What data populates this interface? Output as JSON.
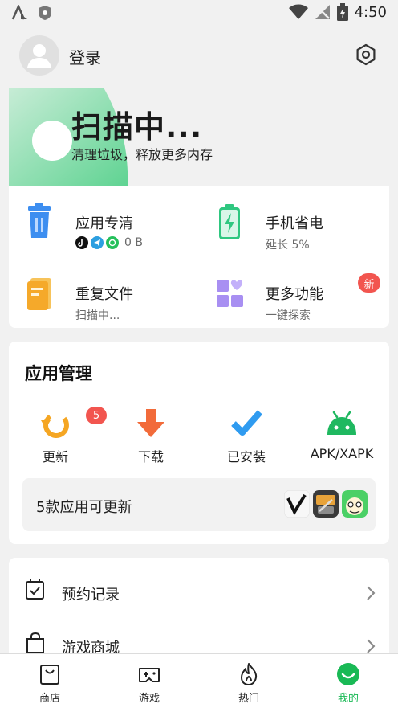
{
  "status_bar": {
    "time": "4:50"
  },
  "header": {
    "login_label": "登录"
  },
  "scan": {
    "title": "扫描中...",
    "subtitle": "清理垃圾，释放更多内存"
  },
  "tools": [
    {
      "name": "应用专清",
      "sub": "0 B"
    },
    {
      "name": "手机省电",
      "sub": "延长 5%"
    },
    {
      "name": "重复文件",
      "sub": "扫描中..."
    },
    {
      "name": "更多功能",
      "sub": "一键探索",
      "badge": "新"
    }
  ],
  "manage": {
    "title": "应用管理",
    "items": [
      {
        "label": "更新",
        "badge": "5"
      },
      {
        "label": "下载"
      },
      {
        "label": "已安装"
      },
      {
        "label": "APK/XAPK"
      }
    ],
    "update_text": "5款应用可更新"
  },
  "list": [
    {
      "label": "预约记录"
    },
    {
      "label": "游戏商城"
    }
  ],
  "tabs": [
    {
      "label": "商店"
    },
    {
      "label": "游戏"
    },
    {
      "label": "热门"
    },
    {
      "label": "我的",
      "active": true
    }
  ],
  "colors": {
    "accent": "#19b955",
    "badge": "#f2554f",
    "background": "#f1f1f1"
  }
}
